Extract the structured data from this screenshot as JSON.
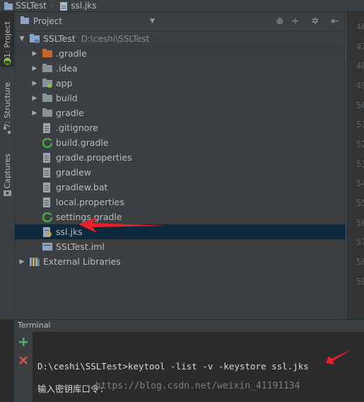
{
  "breadcrumb": [
    "SSLTest",
    "ssl.jks"
  ],
  "toolstrip": {
    "project_tab": "1: Project",
    "structure_tab": "7: Structure",
    "captures_tab": "Captures"
  },
  "project_panel": {
    "view_selector": "Project",
    "root": {
      "name": "SSLTest",
      "path": "D:\\ceshi\\SSLTest"
    },
    "items": [
      {
        "label": "SSLTest",
        "icon": "module-folder-icon",
        "expandable": true,
        "expanded": true
      },
      {
        "label": ".gradle",
        "icon": "folder-orange-icon",
        "expandable": true
      },
      {
        "label": ".idea",
        "icon": "folder-icon",
        "expandable": true
      },
      {
        "label": "app",
        "icon": "module-folder-icon",
        "expandable": true
      },
      {
        "label": "build",
        "icon": "folder-icon",
        "expandable": true
      },
      {
        "label": "gradle",
        "icon": "folder-icon",
        "expandable": true
      },
      {
        "label": ".gitignore",
        "icon": "text-file-icon"
      },
      {
        "label": "build.gradle",
        "icon": "gradle-file-icon"
      },
      {
        "label": "gradle.properties",
        "icon": "properties-file-icon"
      },
      {
        "label": "gradlew",
        "icon": "text-file-icon"
      },
      {
        "label": "gradlew.bat",
        "icon": "text-file-icon"
      },
      {
        "label": "local.properties",
        "icon": "properties-file-icon"
      },
      {
        "label": "settings.gradle",
        "icon": "gradle-file-icon"
      },
      {
        "label": "ssl.jks",
        "icon": "keystore-file-icon",
        "selected": true
      },
      {
        "label": "SSLTest.iml",
        "icon": "iml-file-icon"
      },
      {
        "label": "External Libraries",
        "icon": "libraries-icon",
        "expandable": true
      }
    ]
  },
  "editor_gutter": {
    "line_numbers": [
      "46",
      "47",
      "48",
      "49",
      "50",
      "51",
      "52",
      "53",
      "54",
      "55",
      "56",
      "57",
      "58",
      "59"
    ]
  },
  "terminal": {
    "title": "Terminal",
    "command_line": "D:\\ceshi\\SSLTest>keytool -list -v -keystore ssl.jks",
    "prompt_line": "输入密钥库口令:"
  },
  "watermark": "https://blog.csdn.net/weixin_41191134",
  "colors": {
    "background": "#2b2b2b",
    "panel": "#3c3f41",
    "selection": "#0d293e",
    "annotation_arrow": "#e8202a"
  }
}
